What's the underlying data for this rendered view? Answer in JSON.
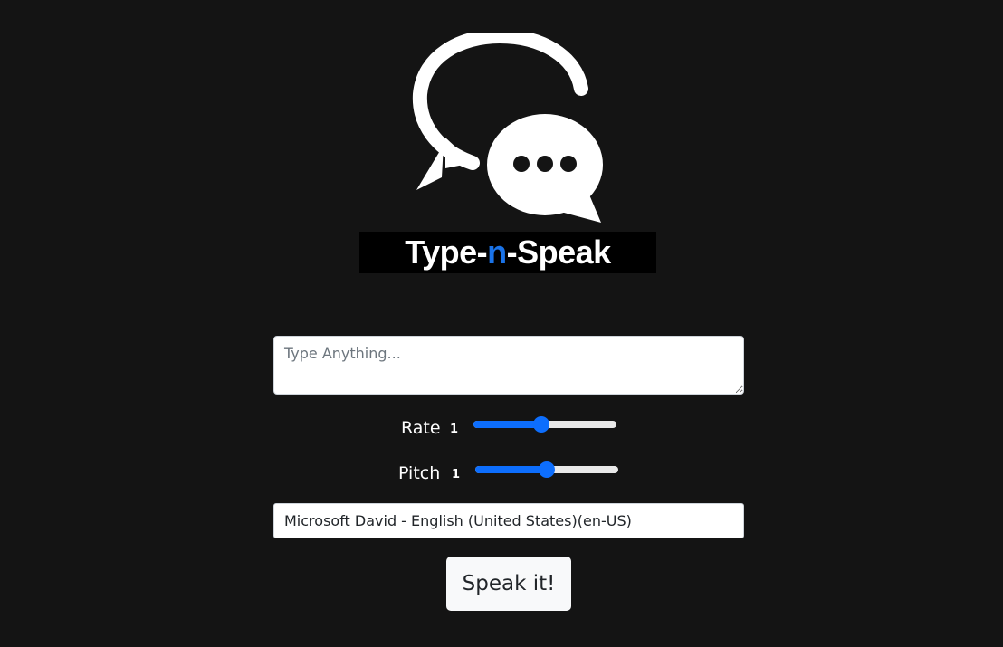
{
  "logo": {
    "text_before": "Type-",
    "text_accent": "n",
    "text_after": "-Speak",
    "accent_color": "#1a73e8",
    "icon": "chat-bubbles-icon"
  },
  "text_input": {
    "placeholder": "Type Anything...",
    "value": ""
  },
  "rate": {
    "label": "Rate",
    "value_text": "1",
    "value": 1,
    "min": 0.1,
    "max": 2
  },
  "pitch": {
    "label": "Pitch",
    "value_text": "1",
    "value": 1,
    "min": 0,
    "max": 2
  },
  "voice_select": {
    "selected": "Microsoft David - English (United States)(en-US)"
  },
  "speak_button": {
    "label": "Speak it!"
  },
  "colors": {
    "background": "#141414",
    "accent": "#0d6efd"
  }
}
